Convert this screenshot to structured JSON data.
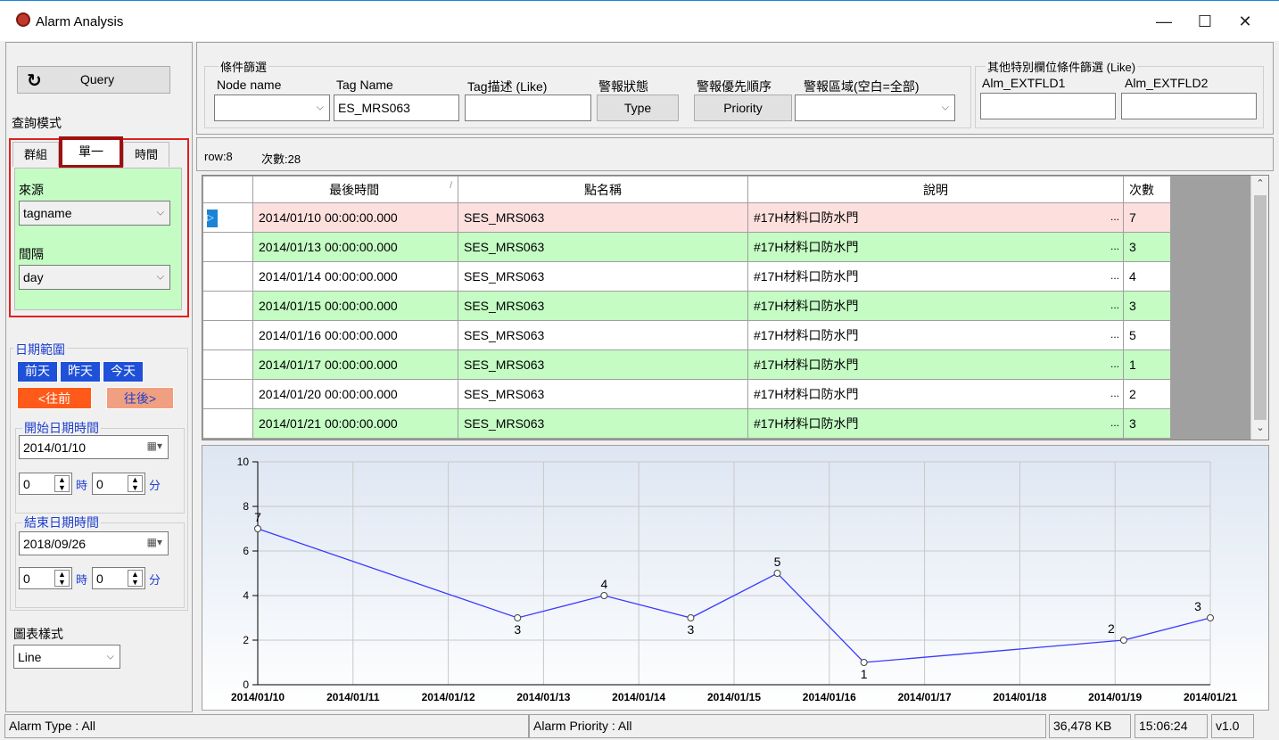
{
  "window": {
    "title": "Alarm Analysis",
    "minimize": "—",
    "maximize": "☐",
    "close": "✕"
  },
  "left": {
    "query_label": "Query",
    "query_mode_label": "查詢模式",
    "tabs": [
      "群組",
      "單一",
      "時間"
    ],
    "source_label": "來源",
    "source_value": "tagname",
    "interval_label": "間隔",
    "interval_value": "day",
    "date_range_label": "日期範圍",
    "day_before": "前天",
    "yesterday": "昨天",
    "today": "今天",
    "prev": "<往前",
    "next": "往後>",
    "start_label": "開始日期時間",
    "start_date": "2014/01/10",
    "start_hour": "0",
    "start_min": "0",
    "hour_unit": "時",
    "min_unit": "分",
    "end_label": "結束日期時間",
    "end_date": "2018/09/26",
    "end_hour": "0",
    "end_min": "0",
    "chart_style_label": "圖表樣式",
    "chart_style_value": "Line"
  },
  "filter": {
    "group_label": "條件篩選",
    "node_name_label": "Node name",
    "node_name_value": "",
    "tag_name_label": "Tag Name",
    "tag_name_value": "ES_MRS063",
    "tag_desc_label": "Tag描述 (Like)",
    "tag_desc_value": "",
    "alarm_state_label": "警報狀態",
    "type_button": "Type",
    "priority_label": "警報優先順序",
    "priority_button": "Priority",
    "area_label": "警報區域(空白=全部)",
    "area_value": "",
    "extra_group_label": "其他特別欄位條件篩選 (Like)",
    "ext1_label": "Alm_EXTFLD1",
    "ext1_value": "",
    "ext2_label": "Alm_EXTFLD2",
    "ext2_value": ""
  },
  "summary": {
    "row": "row:8",
    "count": "次數:28"
  },
  "grid": {
    "headers": [
      "最後時間",
      "點名稱",
      "說明",
      "次數"
    ],
    "sort_glyph": "/",
    "rows": [
      {
        "time": "2014/01/10 00:00:00.000",
        "name": "SES_MRS063",
        "desc": "#17H材料口防水門",
        "count": "7"
      },
      {
        "time": "2014/01/13 00:00:00.000",
        "name": "SES_MRS063",
        "desc": "#17H材料口防水門",
        "count": "3"
      },
      {
        "time": "2014/01/14 00:00:00.000",
        "name": "SES_MRS063",
        "desc": "#17H材料口防水門",
        "count": "4"
      },
      {
        "time": "2014/01/15 00:00:00.000",
        "name": "SES_MRS063",
        "desc": "#17H材料口防水門",
        "count": "3"
      },
      {
        "time": "2014/01/16 00:00:00.000",
        "name": "SES_MRS063",
        "desc": "#17H材料口防水門",
        "count": "5"
      },
      {
        "time": "2014/01/17 00:00:00.000",
        "name": "SES_MRS063",
        "desc": "#17H材料口防水門",
        "count": "1"
      },
      {
        "time": "2014/01/20 00:00:00.000",
        "name": "SES_MRS063",
        "desc": "#17H材料口防水門",
        "count": "2"
      },
      {
        "time": "2014/01/21 00:00:00.000",
        "name": "SES_MRS063",
        "desc": "#17H材料口防水門",
        "count": "3"
      }
    ],
    "ellipsis": "..."
  },
  "chart_data": {
    "type": "line",
    "title": "",
    "xlabel": "",
    "ylabel": "",
    "ylim": [
      0,
      10
    ],
    "yticks": [
      "0",
      "2",
      "4",
      "6",
      "8",
      "10"
    ],
    "xticks": [
      "2014/01/10",
      "2014/01/11",
      "2014/01/12",
      "2014/01/13",
      "2014/01/14",
      "2014/01/15",
      "2014/01/16",
      "2014/01/17",
      "2014/01/18",
      "2014/01/19",
      "2014/01/21"
    ],
    "points": [
      {
        "x": "2014/01/10",
        "y": 7
      },
      {
        "x": "2014/01/13",
        "y": 3
      },
      {
        "x": "2014/01/14",
        "y": 4
      },
      {
        "x": "2014/01/15",
        "y": 3
      },
      {
        "x": "2014/01/16",
        "y": 5
      },
      {
        "x": "2014/01/17",
        "y": 1
      },
      {
        "x": "2014/01/20",
        "y": 2
      },
      {
        "x": "2014/01/21",
        "y": 3
      }
    ],
    "line_color": "#3a3aff",
    "grid": true
  },
  "status": {
    "alarm_type": "Alarm Type : All",
    "alarm_priority": "Alarm Priority : All",
    "memory": "36,478 KB",
    "time": "15:06:24",
    "version": "v1.0"
  },
  "colors": {
    "pink_row": "#fde0de",
    "green_row": "#c4fcc4",
    "highlight_red": "#e02020"
  }
}
